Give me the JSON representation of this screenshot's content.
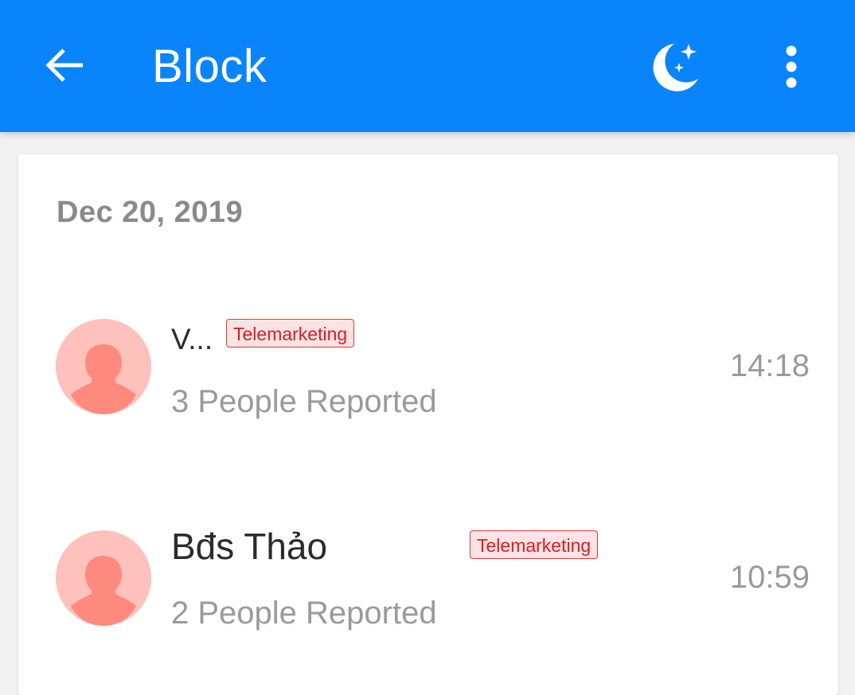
{
  "app_bar": {
    "title": "Block",
    "background_color": "#0a84fb",
    "back_icon": "arrow-left-icon",
    "night_mode_icon": "moon-stars-icon",
    "more_icon": "more-vertical-icon"
  },
  "block_list": {
    "date_header": "Dec 20, 2019",
    "items": [
      {
        "name": "V...",
        "tag": "Telemarketing",
        "reported": "3 People Reported",
        "time": "14:18",
        "avatar_icon": "person-avatar-icon"
      },
      {
        "name": "Bđs Thảo",
        "tag": "Telemarketing",
        "reported": "2 People Reported",
        "time": "10:59",
        "avatar_icon": "person-avatar-icon"
      }
    ]
  },
  "colors": {
    "tag_text": "#d71f1f",
    "tag_background": "#fde3e3",
    "avatar_background": "#ffc1bc",
    "avatar_figure": "#ff8a7d"
  }
}
